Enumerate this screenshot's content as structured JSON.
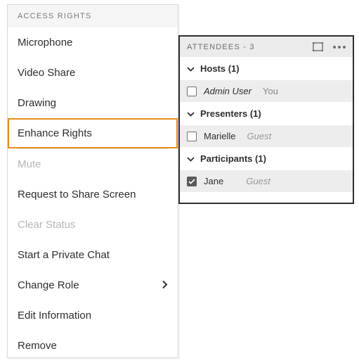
{
  "menu": {
    "header": "ACCESS RIGHTS",
    "items": {
      "microphone": "Microphone",
      "video_share": "Video Share",
      "drawing": "Drawing",
      "enhance_rights": "Enhance Rights",
      "mute": "Mute",
      "request_share": "Request to Share Screen",
      "clear_status": "Clear Status",
      "private_chat": "Start a Private Chat",
      "change_role": "Change Role",
      "edit_info": "Edit Information",
      "remove": "Remove"
    }
  },
  "attendees": {
    "title": "ATTENDEES",
    "count_sep": " - ",
    "count": "3",
    "groups": {
      "hosts": {
        "label": "Hosts (1)"
      },
      "presenters": {
        "label": "Presenters (1)"
      },
      "participants": {
        "label": "Participants (1)"
      }
    },
    "rows": {
      "admin": {
        "name": "Admin User",
        "tag": "You",
        "checked": false,
        "italic": true
      },
      "marielle": {
        "name": "Marielle",
        "tag": "Guest",
        "checked": false,
        "italic": false
      },
      "jane": {
        "name": "Jane",
        "tag": "Guest",
        "checked": true,
        "italic": false
      }
    }
  }
}
